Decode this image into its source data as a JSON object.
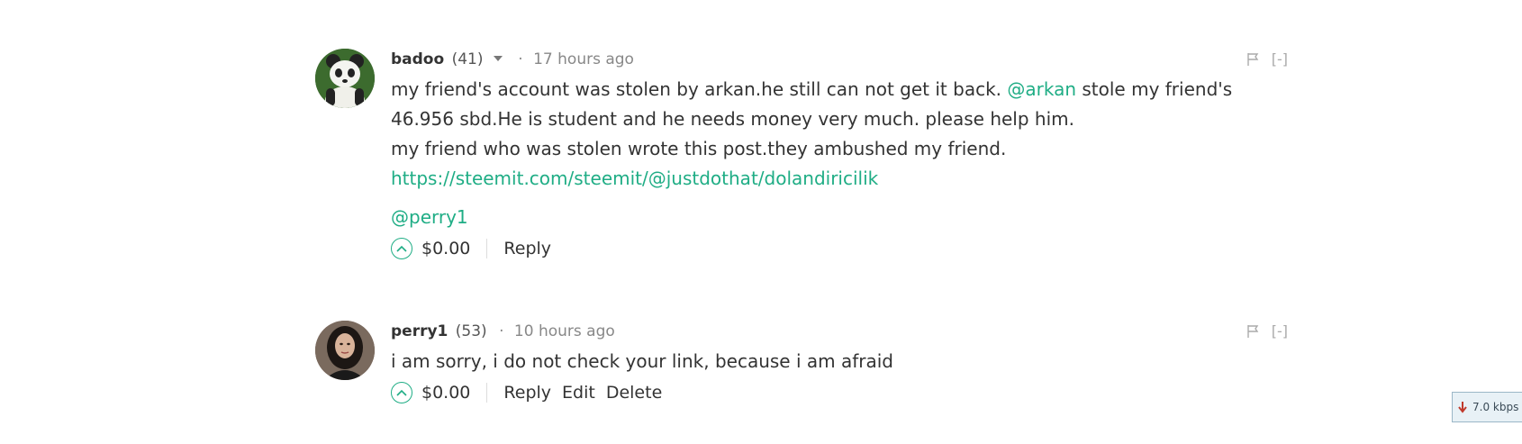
{
  "comments": [
    {
      "author": "badoo",
      "reputation": "(41)",
      "separator": "·",
      "time": "17 hours ago",
      "flag_label": "",
      "collapse_label": "[-]",
      "text": {
        "line1_a": "my friend's account was stolen by arkan.he still can not get it back. ",
        "mention": "@arkan",
        "line1_b": " stole my friend's 46.956 sbd.He is student and he needs money very much. please help him.",
        "line2": "my friend who was stolen wrote this post.they ambushed my friend.",
        "link": "https://steemit.com/steemit/@justdothat/dolandiricilik",
        "mention2": "@perry1"
      },
      "payout": "$0.00",
      "actions": [
        "Reply"
      ]
    },
    {
      "author": "perry1",
      "reputation": "(53)",
      "separator": "·",
      "time": "10 hours ago",
      "collapse_label": "[-]",
      "text": {
        "line1": "i am sorry, i do not check your link, because i am afraid"
      },
      "payout": "$0.00",
      "actions": [
        "Reply",
        "Edit",
        "Delete"
      ]
    }
  ],
  "speed_badge": "7.0 kbps",
  "colors": {
    "accent": "#1fad85",
    "text": "#333333",
    "muted": "#888888"
  }
}
